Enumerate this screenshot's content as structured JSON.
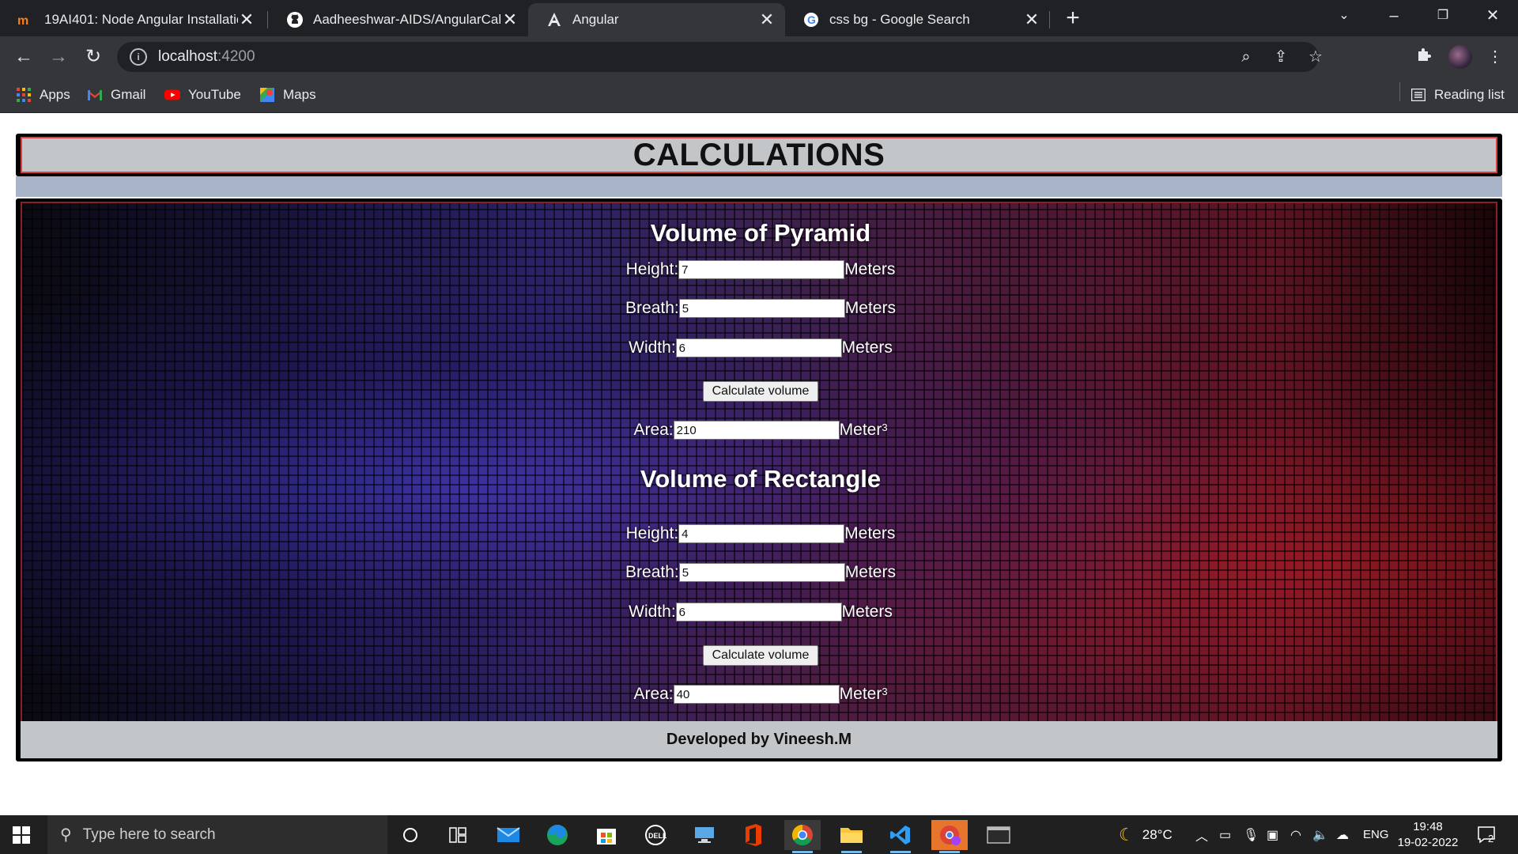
{
  "browser": {
    "tabs": [
      {
        "title": "19AI401: Node Angular Installatio",
        "favicon": "moodle-icon",
        "active": false
      },
      {
        "title": "Aadheeshwar-AIDS/AngularCalcu",
        "favicon": "github-icon",
        "active": false
      },
      {
        "title": "Angular",
        "favicon": "angular-icon",
        "active": true
      },
      {
        "title": "css bg - Google Search",
        "favicon": "google-icon",
        "active": false
      }
    ],
    "close_glyph": "✕",
    "new_tab_glyph": "+",
    "url_host": "localhost",
    "url_port": ":4200",
    "bookmarks": [
      {
        "label": "Apps",
        "icon": "apps-grid-icon"
      },
      {
        "label": "Gmail",
        "icon": "gmail-icon"
      },
      {
        "label": "YouTube",
        "icon": "youtube-icon"
      },
      {
        "label": "Maps",
        "icon": "maps-icon"
      }
    ],
    "reading_list": "Reading list"
  },
  "page": {
    "header_title": "CALCULATIONS",
    "pyramid": {
      "title": "Volume of Pyramid",
      "height_label": "Height:",
      "height_value": "7",
      "breadth_label": "Breath:",
      "breadth_value": "5",
      "width_label": "Width:",
      "width_value": "6",
      "unit": "Meters",
      "button": "Calculate volume",
      "area_label": "Area:",
      "area_value": "210",
      "area_unit": "Meter",
      "area_exp": "3"
    },
    "rectangle": {
      "title": "Volume of Rectangle",
      "height_label": "Height:",
      "height_value": "4",
      "breadth_label": "Breath:",
      "breadth_value": "5",
      "width_label": "Width:",
      "width_value": "6",
      "unit": "Meters",
      "button": "Calculate volume",
      "area_label": "Area:",
      "area_value": "40",
      "area_unit": "Meter",
      "area_exp": "3"
    },
    "footer": "Developed by Vineesh.M"
  },
  "taskbar": {
    "search_placeholder": "Type here to search",
    "weather": "28°C",
    "language": "ENG",
    "time": "19:48",
    "date": "19-02-2022",
    "notifications": "2"
  }
}
